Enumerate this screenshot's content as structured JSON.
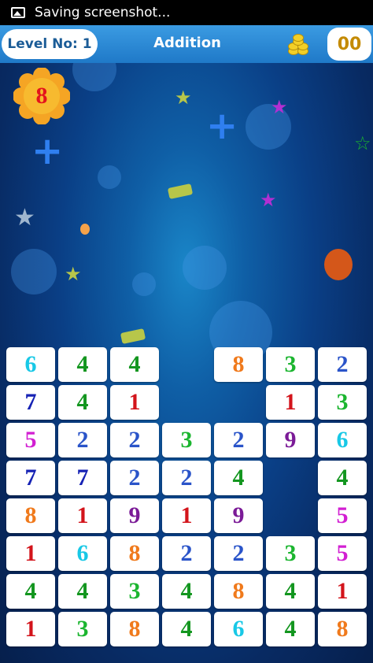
{
  "status": {
    "text": "Saving screenshot..."
  },
  "header": {
    "level": "Level No: 1",
    "mode": "Addition",
    "score": "00"
  },
  "target": {
    "value": "8"
  },
  "colors": {
    "1": "#d3141b",
    "2": "#2a54c9",
    "3": "#1bb52f",
    "4": "#13961f",
    "5": "#d21fd2",
    "6": "#18c8e6",
    "7": "#1622b4",
    "8": "#f07a1c",
    "9": "#7b1b97"
  },
  "grid": {
    "rows": [
      [
        "6",
        "4",
        "4",
        "",
        "8",
        "3",
        "2"
      ],
      [
        "7",
        "4",
        "1",
        "",
        "",
        "1",
        "3"
      ],
      [
        "5",
        "2",
        "2",
        "3",
        "2",
        "9",
        "6"
      ],
      [
        "7",
        "7",
        "2",
        "2",
        "4",
        "",
        "4"
      ],
      [
        "8",
        "1",
        "9",
        "1",
        "9",
        "",
        "5"
      ],
      [
        "1",
        "6",
        "8",
        "2",
        "2",
        "3",
        "5"
      ],
      [
        "4",
        "4",
        "3",
        "4",
        "8",
        "4",
        "1"
      ],
      [
        "1",
        "3",
        "8",
        "4",
        "6",
        "4",
        "8"
      ]
    ]
  }
}
